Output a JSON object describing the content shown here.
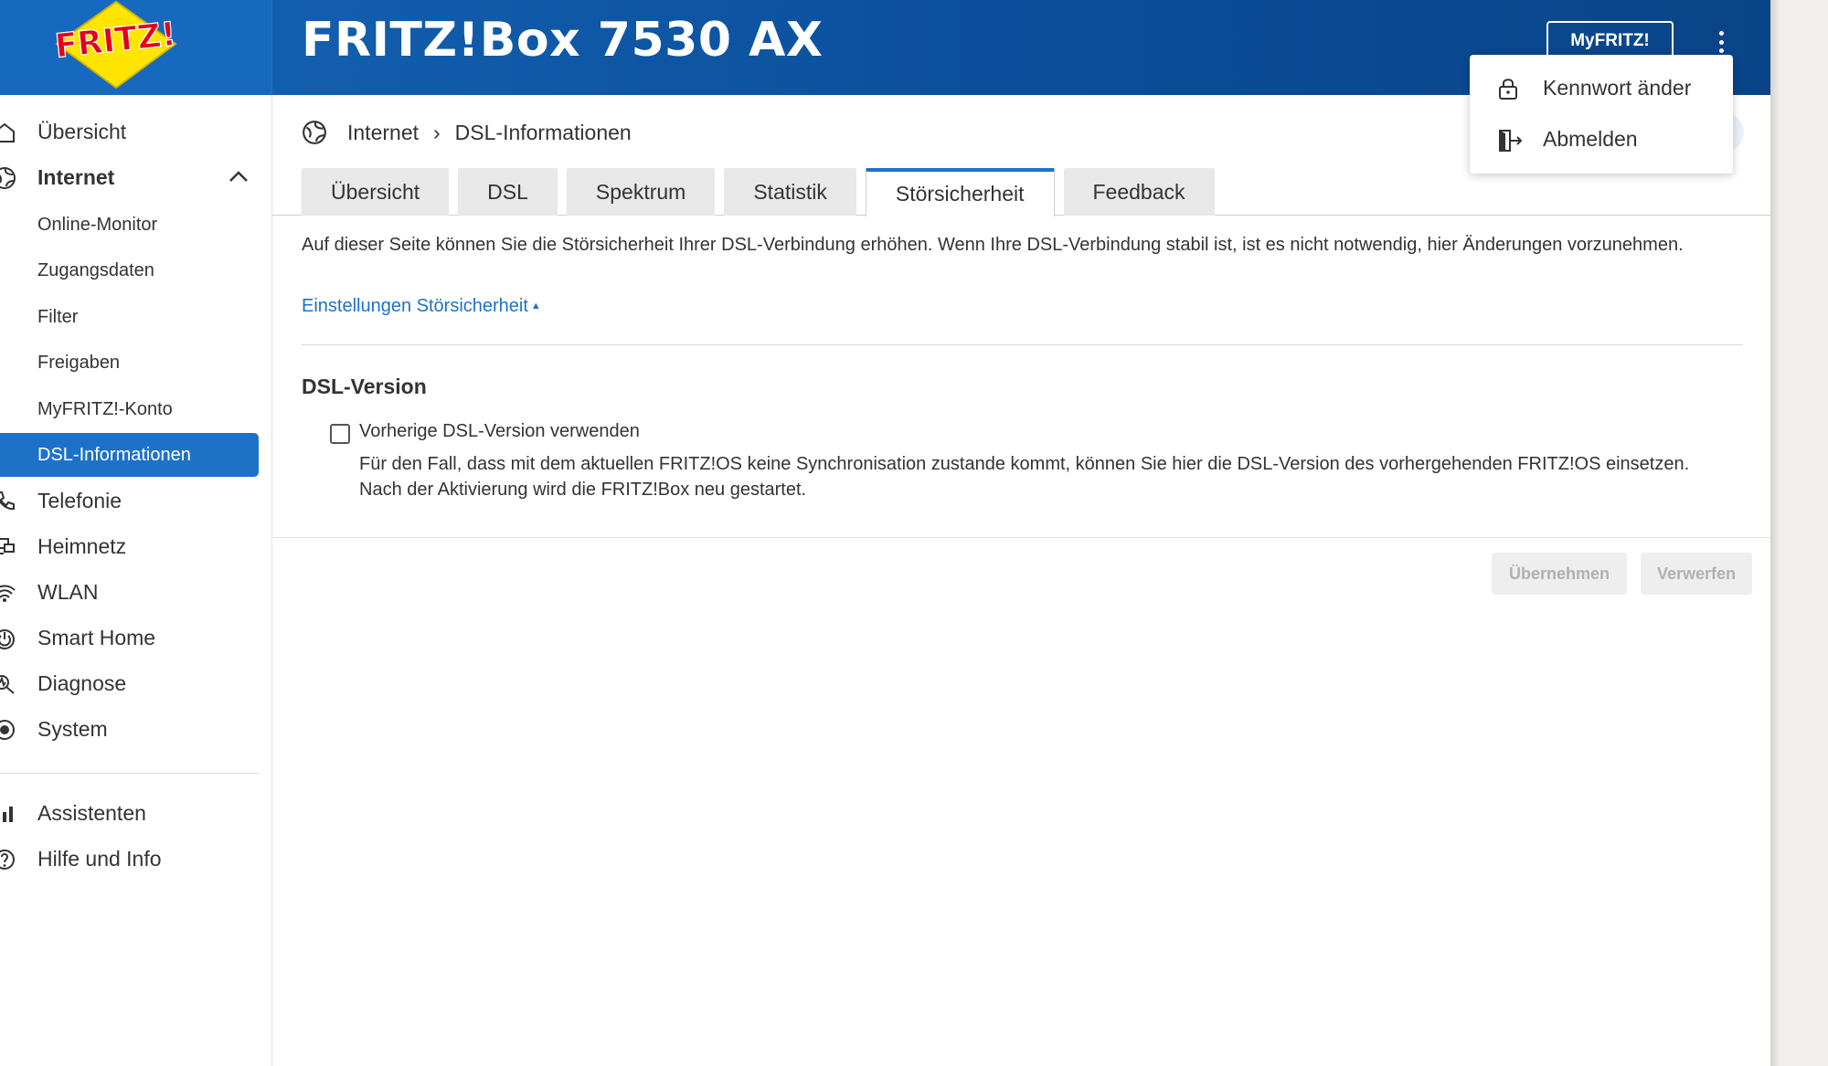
{
  "header": {
    "logo_text": "FRITZ!",
    "product_title": "FRITZ!Box 7530 AX",
    "myfritz_label": "MyFRITZ!"
  },
  "user_menu": {
    "items": [
      {
        "label": "Kennwort änder",
        "icon": "lock-icon"
      },
      {
        "label": "Abmelden",
        "icon": "logout-icon"
      }
    ]
  },
  "sidebar": {
    "items": [
      {
        "label": "Übersicht",
        "icon": "home-icon"
      },
      {
        "label": "Internet",
        "icon": "globe-icon",
        "expanded": true
      },
      {
        "label": "Telefonie",
        "icon": "phone-icon"
      },
      {
        "label": "Heimnetz",
        "icon": "network-icon"
      },
      {
        "label": "WLAN",
        "icon": "wifi-icon"
      },
      {
        "label": "Smart Home",
        "icon": "smart-home-icon"
      },
      {
        "label": "Diagnose",
        "icon": "diagnose-icon"
      },
      {
        "label": "System",
        "icon": "system-icon"
      }
    ],
    "internet_subitems": [
      {
        "label": "Online-Monitor"
      },
      {
        "label": "Zugangsdaten"
      },
      {
        "label": "Filter"
      },
      {
        "label": "Freigaben"
      },
      {
        "label": "MyFRITZ!-Konto"
      },
      {
        "label": "DSL-Informationen",
        "active": true
      }
    ],
    "footer_items": [
      {
        "label": "Assistenten",
        "icon": "wizard-icon"
      },
      {
        "label": "Hilfe und Info",
        "icon": "help-icon"
      }
    ]
  },
  "breadcrumb": {
    "parent": "Internet",
    "separator": "›",
    "current": "DSL-Informationen"
  },
  "tabs": [
    {
      "label": "Übersicht"
    },
    {
      "label": "DSL"
    },
    {
      "label": "Spektrum"
    },
    {
      "label": "Statistik"
    },
    {
      "label": "Störsicherheit",
      "active": true
    },
    {
      "label": "Feedback"
    }
  ],
  "content": {
    "intro": "Auf dieser Seite können Sie die Störsicherheit Ihrer DSL-Verbindung erhöhen. Wenn Ihre DSL-Verbindung stabil ist, ist es nicht notwendig, hier Änderungen vorzunehmen.",
    "settings_link": "Einstellungen Störsicherheit",
    "section_title": "DSL-Version",
    "checkbox_label": "Vorherige DSL-Version verwenden",
    "checkbox_checked": false,
    "checkbox_help": "Für den Fall, dass mit dem aktuellen FRITZ!OS keine Synchronisation zustande kommt, können Sie hier die DSL-Version des vorhergehenden FRITZ!OS einsetzen. Nach der Aktivierung wird die FRITZ!Box neu gestartet."
  },
  "actions": {
    "apply_label": "Übernehmen",
    "discard_label": "Verwerfen"
  },
  "colors": {
    "header_blue": "#0b4f9c",
    "accent_blue": "#1d72c8",
    "logo_red": "#e2001a",
    "logo_yellow": "#ffe500"
  }
}
